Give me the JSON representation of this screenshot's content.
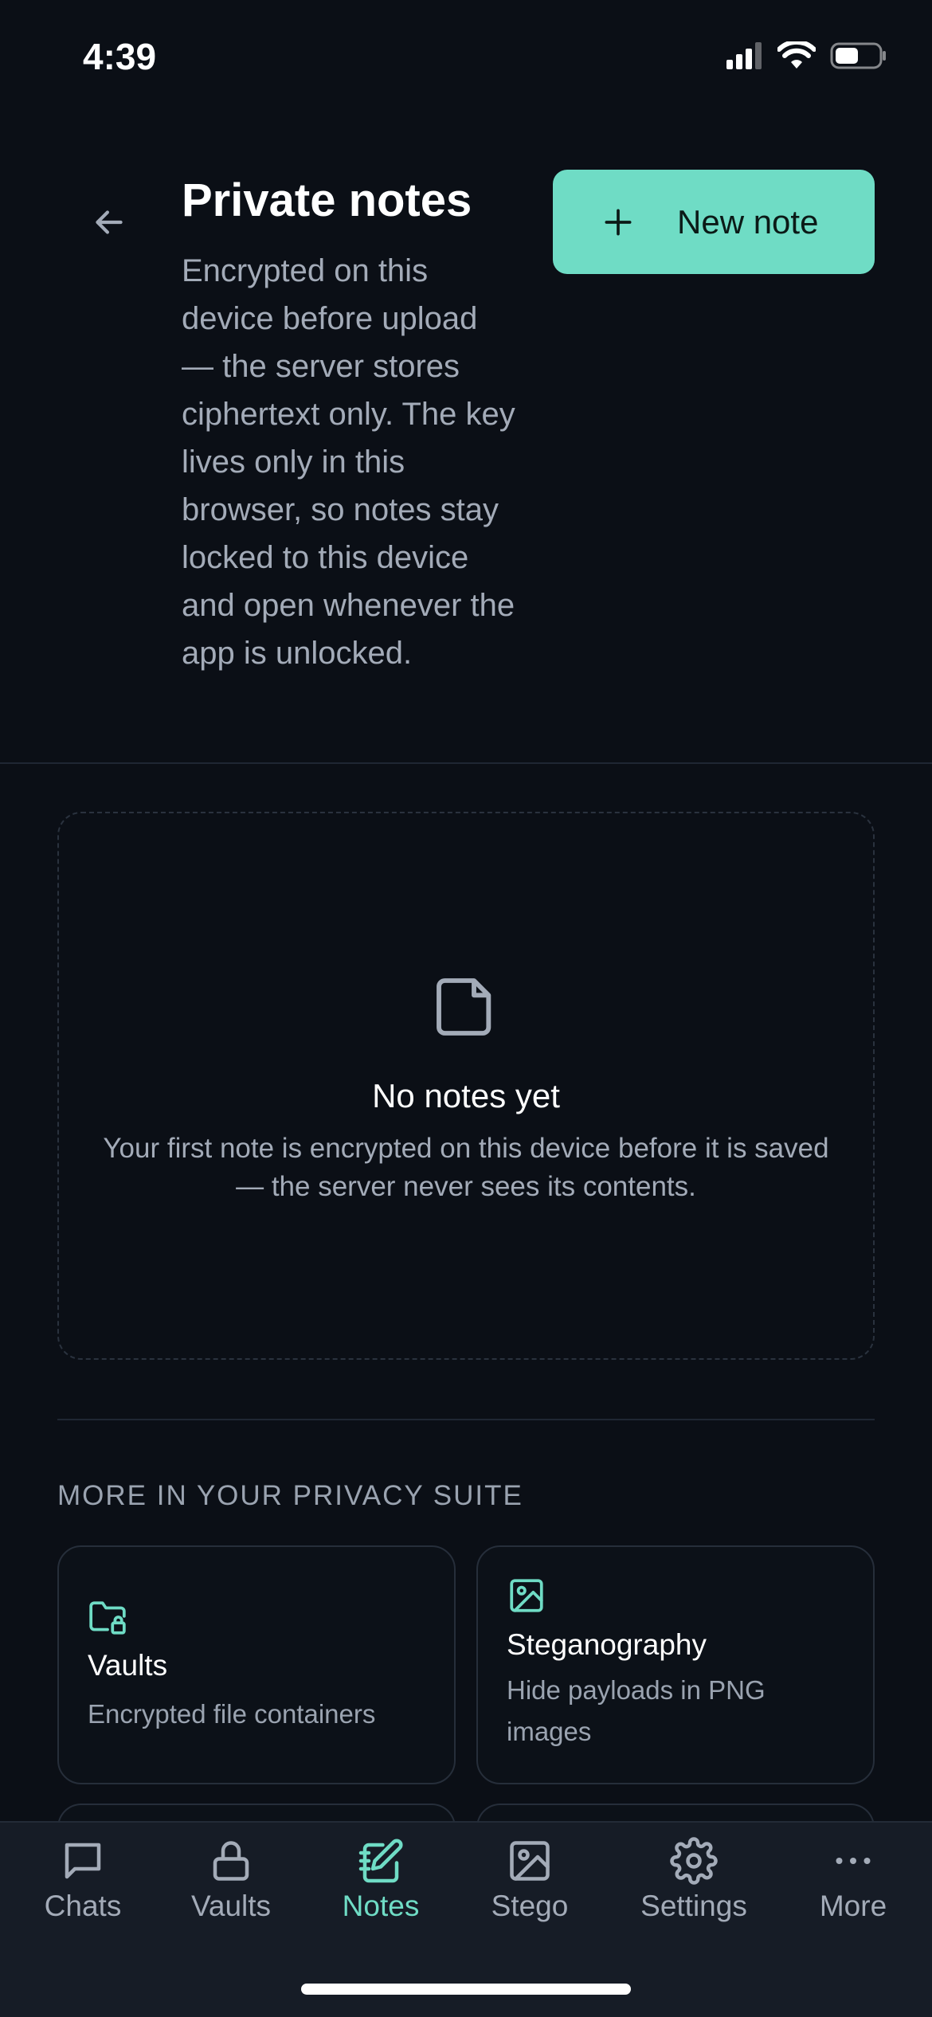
{
  "status_bar": {
    "time": "4:39"
  },
  "header": {
    "title": "Private notes",
    "description": "Encrypted on this device before upload — the server stores ciphertext only. The key lives only in this browser, so notes stay locked to this device and open whenever the app is unlocked.",
    "new_note_label": "New note"
  },
  "empty_state": {
    "icon": "note-icon",
    "title": "No notes yet",
    "text": "Your first note is encrypted on this device before it is saved — the server never sees its contents."
  },
  "suite": {
    "label": "MORE IN YOUR PRIVACY SUITE",
    "cards": [
      {
        "icon": "folder-lock-icon",
        "title": "Vaults",
        "subtitle": "Encrypted file containers"
      },
      {
        "icon": "image-icon",
        "title": "Steganography",
        "subtitle": "Hide payloads in PNG images"
      }
    ]
  },
  "tabs": [
    {
      "label": "Chats",
      "icon": "chat-icon",
      "active": false
    },
    {
      "label": "Vaults",
      "icon": "lock-icon",
      "active": false
    },
    {
      "label": "Notes",
      "icon": "notebook-icon",
      "active": true
    },
    {
      "label": "Stego",
      "icon": "image-icon",
      "active": false
    },
    {
      "label": "Settings",
      "icon": "gear-icon",
      "active": false
    },
    {
      "label": "More",
      "icon": "more-icon",
      "active": false
    }
  ],
  "colors": {
    "accent": "#6fdcc5",
    "background": "#0b0f16",
    "tabbar": "#161c26"
  }
}
